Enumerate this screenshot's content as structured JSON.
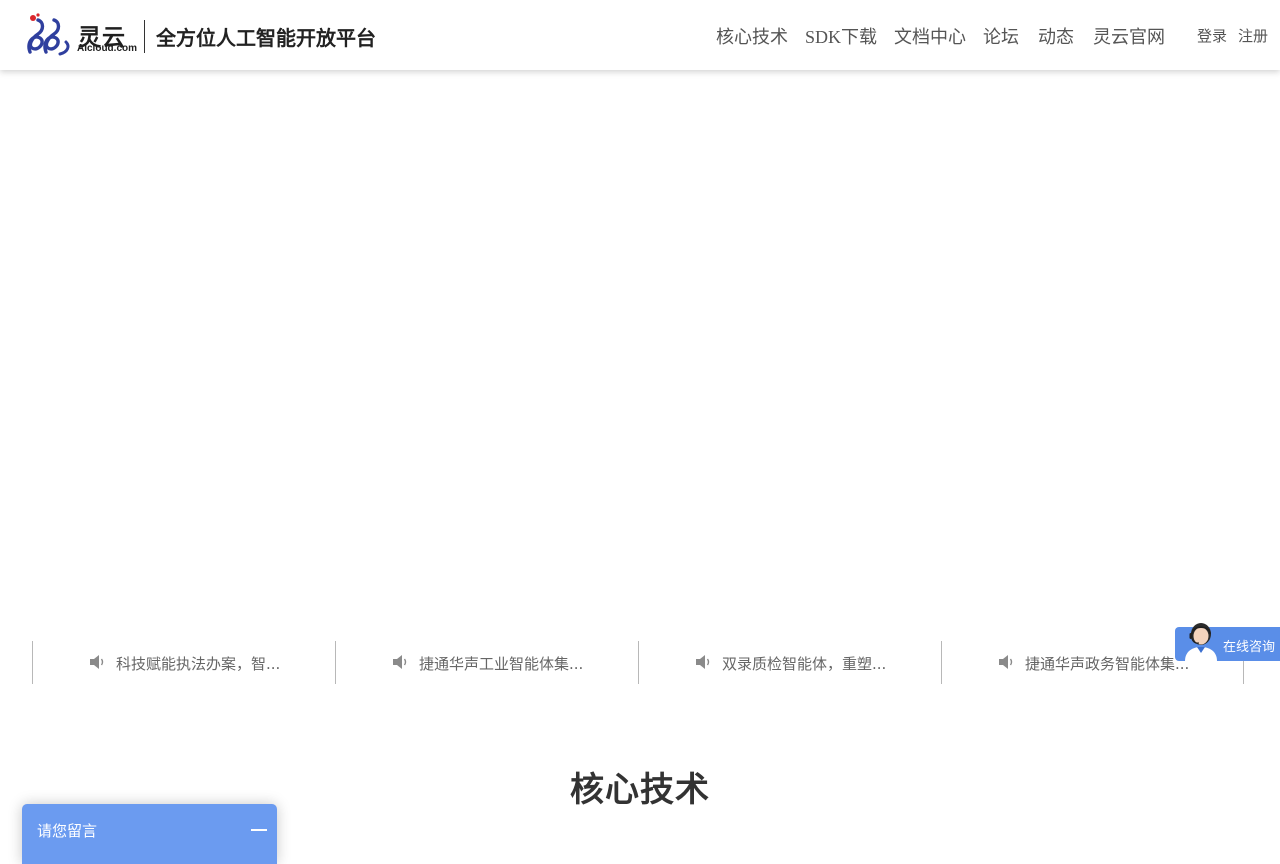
{
  "header": {
    "logo": {
      "name": "灵云",
      "domain": "AIcloud.com",
      "icon": "lingyun-logo-icon",
      "brand_color": "#2f3f9e",
      "accent_color": "#d9262c"
    },
    "platform_title": "全方位人工智能开放平台",
    "nav": [
      {
        "label": "核心技术"
      },
      {
        "label": "SDK下载"
      },
      {
        "label": "文档中心"
      },
      {
        "label": "论坛"
      },
      {
        "label": "动态"
      },
      {
        "label": "灵云官网"
      }
    ],
    "auth": {
      "login": "登录",
      "register": "注册"
    }
  },
  "news": {
    "icon": "speaker-icon",
    "items": [
      {
        "text": "科技赋能执法办案，智..."
      },
      {
        "text": "捷通华声工业智能体集..."
      },
      {
        "text": "双录质检智能体，重塑..."
      },
      {
        "text": "捷通华声政务智能体集..."
      }
    ]
  },
  "consult": {
    "label": "在线咨询",
    "icon": "customer-service-avatar-icon",
    "color": "#5a8ee8"
  },
  "section": {
    "title": "核心技术"
  },
  "message_widget": {
    "label": "请您留言",
    "icon": "minimize-icon",
    "color": "#6b9bf0"
  }
}
